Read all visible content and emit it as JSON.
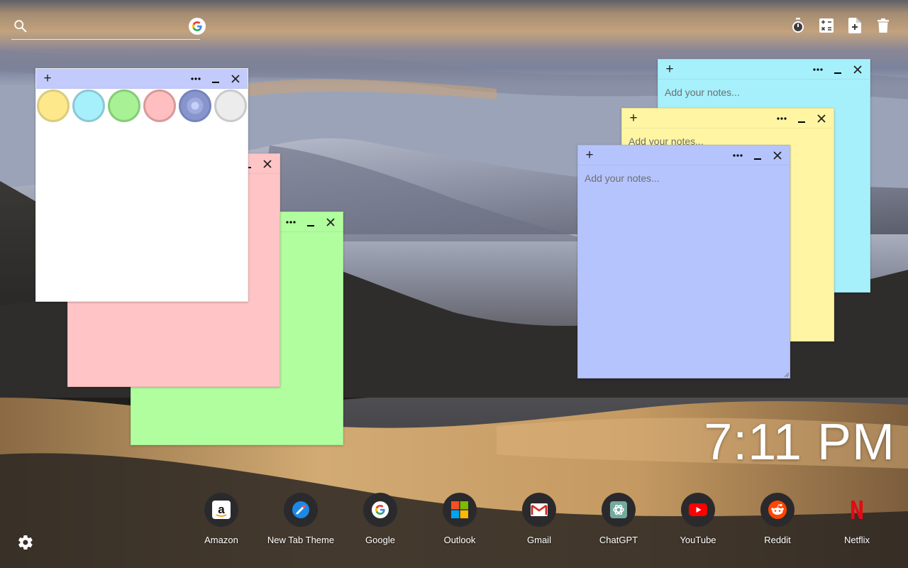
{
  "search": {
    "value": "",
    "placeholder": ""
  },
  "toolbar": {
    "items": [
      {
        "icon": "stopwatch-icon"
      },
      {
        "icon": "calculator-icon"
      },
      {
        "icon": "new-note-icon"
      },
      {
        "icon": "trash-icon"
      }
    ]
  },
  "notes": {
    "placeholder": "Add your notes...",
    "colors": {
      "white": "#ffffff",
      "pink": "#ffc5c6",
      "green": "#b1fe9e",
      "cyan": "#a6f0fc",
      "yellow": "#fff5a3",
      "blue": "#b6c4fe",
      "titlebar_blue": "#c3cbfc"
    },
    "color_picker": [
      "#fde98c",
      "#a6f0fc",
      "#a8f195",
      "#ffbfc0",
      "#7f8fc8",
      "#ececec"
    ],
    "cyan_note": {
      "text": ""
    },
    "yellow_note": {
      "text": ""
    },
    "blue_note": {
      "text": ""
    }
  },
  "clock": {
    "time": "7:11 PM"
  },
  "shortcuts": [
    {
      "label": "Amazon",
      "icon": "amazon-icon"
    },
    {
      "label": "New Tab Theme",
      "icon": "new-tab-theme-icon"
    },
    {
      "label": "Google",
      "icon": "google-icon"
    },
    {
      "label": "Outlook",
      "icon": "outlook-icon"
    },
    {
      "label": "Gmail",
      "icon": "gmail-icon"
    },
    {
      "label": "ChatGPT",
      "icon": "chatgpt-icon"
    },
    {
      "label": "YouTube",
      "icon": "youtube-icon"
    },
    {
      "label": "Reddit",
      "icon": "reddit-icon"
    },
    {
      "label": "Netflix",
      "icon": "netflix-icon"
    }
  ],
  "settings": {
    "icon": "gear-icon"
  }
}
